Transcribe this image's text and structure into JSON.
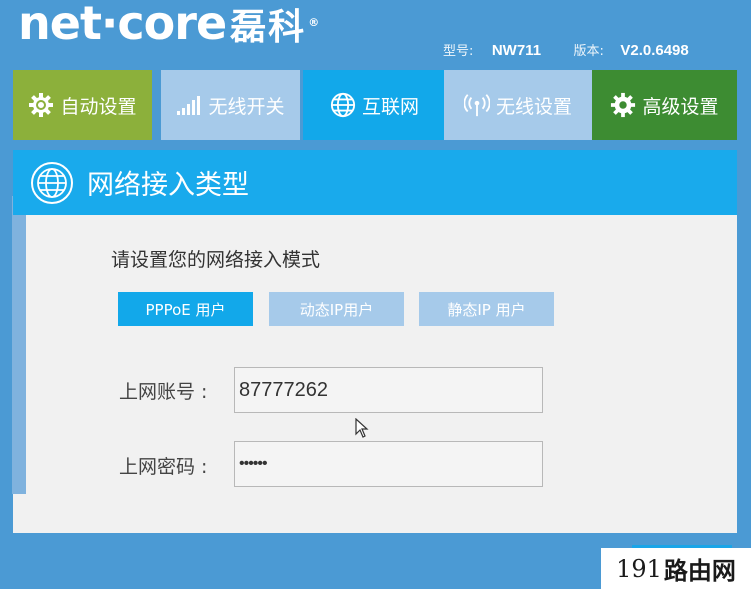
{
  "brand": {
    "name": "net·core",
    "cn_name": "磊科",
    "reg_mark": "®"
  },
  "device": {
    "model_label": "型号:",
    "model": "NW711",
    "version_label": "版本:",
    "version": "V2.0.6498"
  },
  "nav": {
    "tabs": [
      {
        "label": "自动设置",
        "icon": "gear-refresh-icon"
      },
      {
        "label": "无线开关",
        "icon": "signal-bars-icon"
      },
      {
        "label": "互联网",
        "icon": "globe-icon"
      },
      {
        "label": "无线设置",
        "icon": "antenna-icon"
      },
      {
        "label": "高级设置",
        "icon": "gear-icon"
      }
    ],
    "active_tab": "互联网"
  },
  "panel": {
    "title": "网络接入类型",
    "prompt": "请设置您的网络接入模式",
    "modes": [
      {
        "label": "PPPoE 用户",
        "active": true
      },
      {
        "label": "动态IP用户",
        "active": false
      },
      {
        "label": "静态IP 用户",
        "active": false
      }
    ],
    "fields": {
      "account_label": "上网账号 :",
      "account_value": "87777262",
      "password_label": "上网密码 :",
      "password_value": "••••••"
    }
  },
  "watermark": {
    "num": "191",
    "text": "路由网"
  },
  "colors": {
    "background": "#4b9ad4",
    "accent_blue": "#12a8ea",
    "inactive_tab": "#a6caea",
    "auto_green": "#8cb03b",
    "advanced_green": "#3d8c32"
  }
}
